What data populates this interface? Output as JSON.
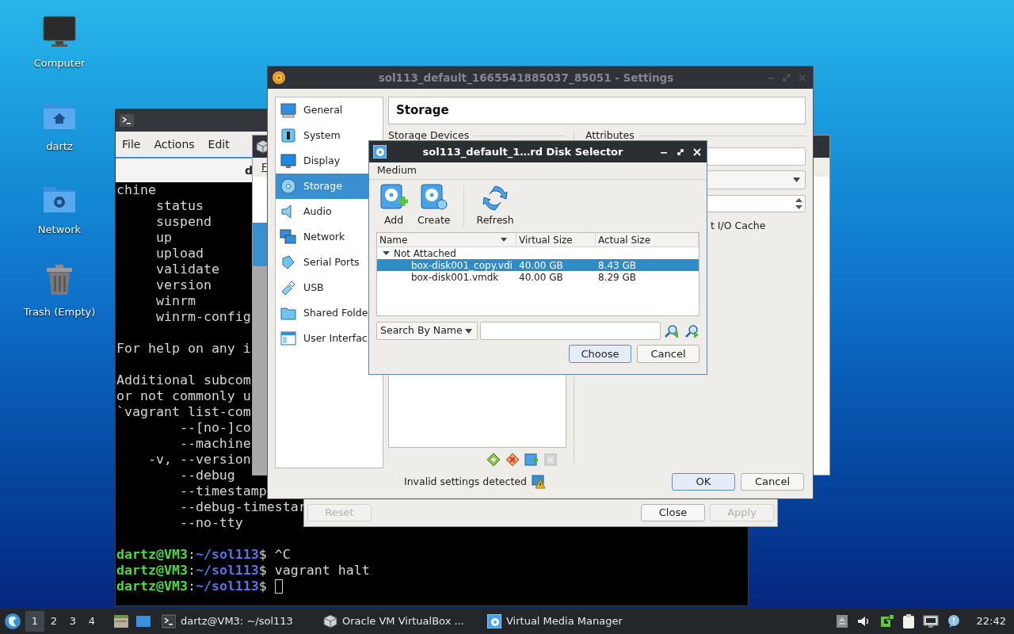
{
  "desktop_icons": [
    {
      "label": "Computer",
      "kind": "computer"
    },
    {
      "label": "dartz",
      "kind": "home"
    },
    {
      "label": "Network",
      "kind": "network"
    },
    {
      "label": "Trash (Empty)",
      "kind": "trash"
    }
  ],
  "terminal": {
    "menu": [
      "File",
      "Actions",
      "Edit"
    ],
    "tab_label": "d",
    "lines": [
      {
        "kind": "output",
        "text": "chine"
      },
      {
        "kind": "output",
        "text": "     status"
      },
      {
        "kind": "output",
        "text": "     suspend"
      },
      {
        "kind": "output",
        "text": "     up"
      },
      {
        "kind": "output",
        "text": "     upload"
      },
      {
        "kind": "output",
        "text": "     validate"
      },
      {
        "kind": "output",
        "text": "     version"
      },
      {
        "kind": "output",
        "text": "     winrm"
      },
      {
        "kind": "output",
        "text": "     winrm-config"
      },
      {
        "kind": "blank"
      },
      {
        "kind": "output",
        "text": "For help on any i"
      },
      {
        "kind": "blank"
      },
      {
        "kind": "output",
        "text": "Additional subcom"
      },
      {
        "kind": "output",
        "text": "or not commonly u"
      },
      {
        "kind": "output",
        "text": "`vagrant list-com"
      },
      {
        "kind": "output",
        "text": "        --[no-]co"
      },
      {
        "kind": "output",
        "text": "        --machine"
      },
      {
        "kind": "output",
        "text": "    -v, --version"
      },
      {
        "kind": "output",
        "text": "        --debug"
      },
      {
        "kind": "output",
        "text": "        --timestamp"
      },
      {
        "kind": "output",
        "text": "        --debug-timestar"
      },
      {
        "kind": "output",
        "text": "        --no-tty"
      },
      {
        "kind": "blank"
      },
      {
        "kind": "prompt",
        "user": "dartz@VM3",
        "separator": ":",
        "path": "~/sol113",
        "symbol": "$",
        "command": "^C"
      },
      {
        "kind": "prompt",
        "user": "dartz@VM3",
        "separator": ":",
        "path": "~/sol113",
        "symbol": "$",
        "command": "vagrant halt"
      },
      {
        "kind": "prompt",
        "user": "dartz@VM3",
        "separator": ":",
        "path": "~/sol113",
        "symbol": "$",
        "cursor": true
      }
    ]
  },
  "virtualbox_manager": {
    "menu": [
      "F"
    ]
  },
  "media_manager": {
    "buttons": [
      {
        "label": "Reset",
        "disabled": true
      },
      {
        "label": "Close",
        "disabled": false
      },
      {
        "label": "Apply",
        "disabled": true
      }
    ]
  },
  "settings": {
    "title": "sol113_default_1665541885037_85051 - Settings",
    "sections": [
      {
        "label": "General",
        "kind": "general",
        "selected": false
      },
      {
        "label": "System",
        "kind": "system",
        "selected": false
      },
      {
        "label": "Display",
        "kind": "display",
        "selected": false
      },
      {
        "label": "Storage",
        "kind": "storage",
        "selected": true
      },
      {
        "label": "Audio",
        "kind": "audio",
        "selected": false
      },
      {
        "label": "Network",
        "kind": "network",
        "selected": false
      },
      {
        "label": "Serial Ports",
        "kind": "serial",
        "selected": false
      },
      {
        "label": "USB",
        "kind": "usb",
        "selected": false
      },
      {
        "label": "Shared Folde",
        "kind": "shared",
        "selected": false
      },
      {
        "label": "User Interfac",
        "kind": "ui",
        "selected": false
      }
    ],
    "page_title": "Storage",
    "storage_devices_label": "Storage Devices",
    "attributes_label": "Attributes",
    "io_cache_label": "t I/O Cache",
    "status_text": "Invalid settings detected",
    "buttons": [
      {
        "label": "OK",
        "default": true
      },
      {
        "label": "Cancel",
        "default": false
      }
    ]
  },
  "disk_selector": {
    "title": "sol113_default_1…rd Disk Selector",
    "menu": [
      "Medium"
    ],
    "toolbar": [
      {
        "label": "Add",
        "kind": "add"
      },
      {
        "label": "Create",
        "kind": "create"
      },
      {
        "label": "Refresh",
        "kind": "refresh"
      }
    ],
    "columns": [
      "Name",
      "Virtual Size",
      "Actual Size"
    ],
    "groups": [
      {
        "label": "Not Attached",
        "expanded": true,
        "children": [
          {
            "name": "box-disk001_copy.vdi",
            "virtual_size": "40.00 GB",
            "actual_size": "8.43 GB",
            "selected": true
          },
          {
            "name": "box-disk001.vmdk",
            "virtual_size": "40.00 GB",
            "actual_size": "8.29 GB",
            "selected": false
          }
        ]
      }
    ],
    "search": {
      "mode": "Search By Name"
    },
    "buttons": [
      {
        "label": "Choose",
        "default": true
      },
      {
        "label": "Cancel",
        "default": false
      }
    ]
  },
  "taskbar": {
    "workspaces": [
      {
        "label": "1",
        "selected": true
      },
      {
        "label": "2",
        "selected": false
      },
      {
        "label": "3",
        "selected": false
      },
      {
        "label": "4",
        "selected": false
      }
    ],
    "tasks": [
      {
        "label": "dartz@VM3: ~/sol113",
        "kind": "terminal"
      },
      {
        "label": "Oracle VM VirtualBox ...",
        "kind": "virtualbox"
      },
      {
        "label": "Virtual Media Manager",
        "kind": "media"
      }
    ],
    "clock": "22:42"
  }
}
